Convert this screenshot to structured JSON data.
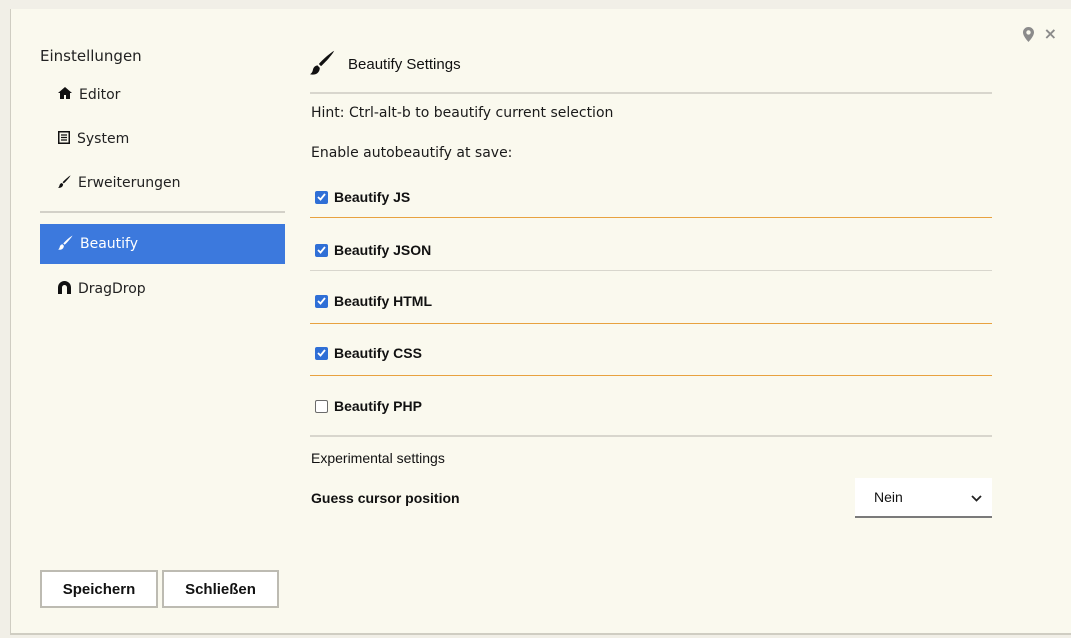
{
  "sidebar": {
    "title": "Einstellungen",
    "items": [
      {
        "label": "Editor",
        "icon": "home-icon",
        "active": false
      },
      {
        "label": "System",
        "icon": "document-icon",
        "active": false
      },
      {
        "label": "Erweiterungen",
        "icon": "brush-icon",
        "active": false
      },
      {
        "label": "Beautify",
        "icon": "brush-icon",
        "active": true
      },
      {
        "label": "DragDrop",
        "icon": "magnet-icon",
        "active": false
      }
    ]
  },
  "buttons": {
    "save": "Speichern",
    "close": "Schließen"
  },
  "content": {
    "title": "Beautify Settings",
    "title_icon": "brush-icon",
    "hint": "Hint: Ctrl-alt-b to beautify current selection",
    "autobeautify_label": "Enable autobeautify at save:",
    "checkboxes": [
      {
        "label": "Beautify JS",
        "checked": true
      },
      {
        "label": "Beautify JSON",
        "checked": true
      },
      {
        "label": "Beautify HTML",
        "checked": true
      },
      {
        "label": "Beautify CSS",
        "checked": true
      },
      {
        "label": "Beautify PHP",
        "checked": false
      }
    ],
    "experimental_title": "Experimental settings",
    "guess_cursor_label": "Guess cursor position",
    "guess_cursor_value": "Nein"
  },
  "window_controls": [
    "pin-icon",
    "close-icon"
  ],
  "colors": {
    "accent": "#3c79dd",
    "checkbox": "#2f6fd6",
    "separator_orange": "#e8a23f",
    "background": "#faf9ee"
  }
}
